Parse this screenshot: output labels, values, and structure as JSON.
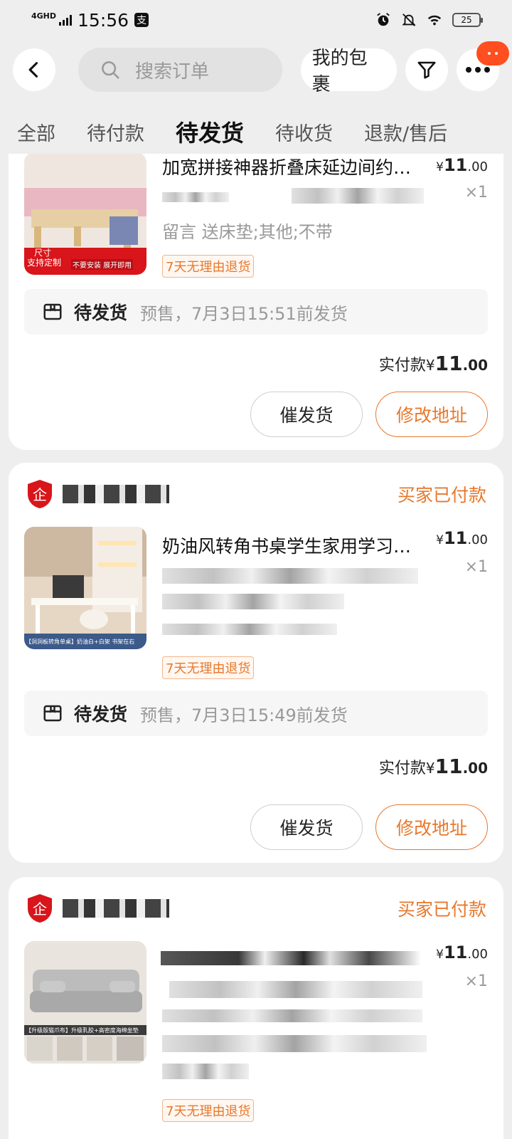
{
  "status_bar": {
    "network": "4GHD",
    "time": "15:56",
    "battery": "25"
  },
  "header": {
    "search_placeholder": "搜索订单",
    "packages_label": "我的包裹"
  },
  "tabs": [
    {
      "label": "全部"
    },
    {
      "label": "待付款"
    },
    {
      "label": "待发货",
      "active": true
    },
    {
      "label": "待收货"
    },
    {
      "label": "退款/售后"
    }
  ],
  "orders": [
    {
      "title": "加宽拼接神器折叠床延边间约…",
      "price_currency": "¥",
      "price_int": "11",
      "price_dec": ".00",
      "qty": "×1",
      "note": "留言 送床垫;其他;不带",
      "tag": "7天无理由退货",
      "ship_label": "待发货",
      "ship_desc": "预售，7月3日15:51前发货",
      "paid_label": "实付款",
      "paid_currency": "¥",
      "paid_int": "11",
      "paid_dec": ".00",
      "btn_remind": "催发货",
      "btn_address": "修改地址",
      "thumb_text": [
        "尺寸",
        "支持定制",
        "不要安装 展开即用"
      ]
    },
    {
      "status": "买家已付款",
      "title": "奶油风转角书桌学生家用学习…",
      "price_currency": "¥",
      "price_int": "11",
      "price_dec": ".00",
      "qty": "×1",
      "tag": "7天无理由退货",
      "ship_label": "待发货",
      "ship_desc": "预售，7月3日15:49前发货",
      "paid_label": "实付款",
      "paid_currency": "¥",
      "paid_int": "11",
      "paid_dec": ".00",
      "btn_remind": "催发货",
      "btn_address": "修改地址",
      "thumb_text": [
        "【洞洞板转角单桌】奶油白+白架 书架在右"
      ]
    },
    {
      "status": "买家已付款",
      "price_currency": "¥",
      "price_int": "11",
      "price_dec": ".00",
      "qty": "×1",
      "tag": "7天无理由退货",
      "thumb_text": [
        "【升级版猫爪布】升级乳胶+高密度海绵坐垫"
      ]
    }
  ],
  "colors": {
    "accent": "#e8782c",
    "badge": "#ff4e1f",
    "background": "#eeeeee"
  }
}
